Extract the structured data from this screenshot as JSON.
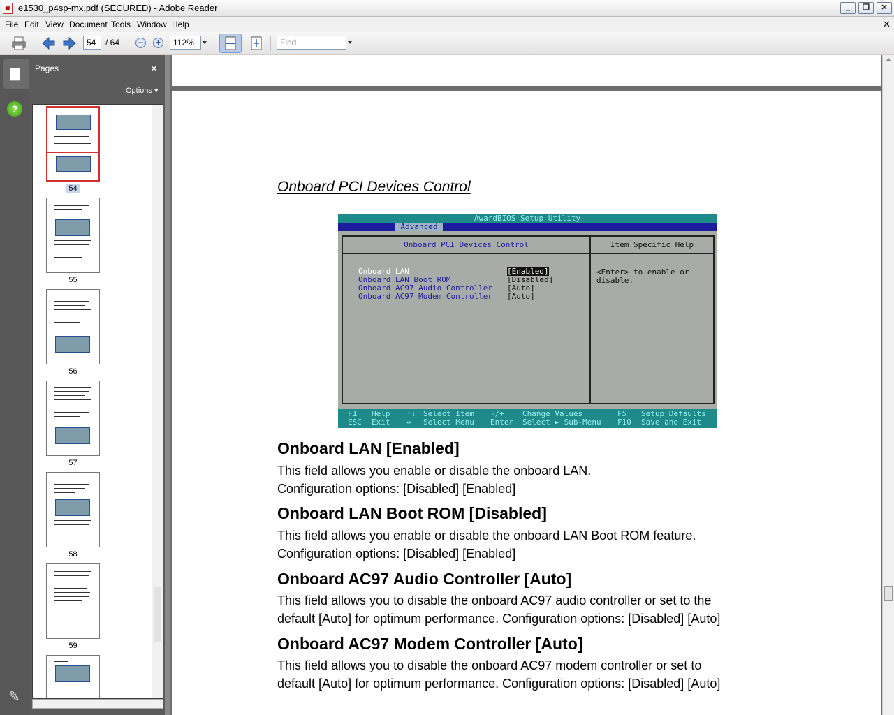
{
  "window": {
    "title": "e1530_p4sp-mx.pdf (SECURED) - Adobe Reader"
  },
  "menu": [
    "File",
    "Edit",
    "View",
    "Document",
    "Tools",
    "Window",
    "Help"
  ],
  "toolbar": {
    "current_page": "54",
    "page_total": "/ 64",
    "zoom": "112%",
    "find_placeholder": "Find"
  },
  "panel": {
    "title": "Pages",
    "options": "Options",
    "close": "×"
  },
  "thumbnails": [
    {
      "label": "54",
      "selected": true
    },
    {
      "label": "55"
    },
    {
      "label": "56"
    },
    {
      "label": "57"
    },
    {
      "label": "58"
    },
    {
      "label": "59"
    }
  ],
  "doc": {
    "section_title": "Onboard PCI Devices Control",
    "bios": {
      "utility": "AwardBIOS Setup Utility",
      "tab": "Advanced",
      "main_header": "Onboard PCI Devices Control",
      "help_header": "Item Specific Help",
      "items": [
        {
          "name": "Onboard LAN",
          "value": "[Enabled]"
        },
        {
          "name": "Onboard LAN Boot ROM",
          "value": "[Disabled]"
        },
        {
          "name": "Onboard AC97 Audio Controller",
          "value": "[Auto]"
        },
        {
          "name": "Onboard AC97 Modem Controller",
          "value": "[Auto]"
        }
      ],
      "help_text": "<Enter> to enable or disable.",
      "footer": {
        "k1": "F1",
        "d1": "Help",
        "k2": "↑↓",
        "d2": "Select Item",
        "k3": "-/+",
        "d3": "Change Values",
        "k4": "F5",
        "d4": "Setup Defaults",
        "k5": "ESC",
        "d5": "Exit",
        "k6": "↔",
        "d6": "Select Menu",
        "k7": "Enter",
        "d7": "Select ► Sub-Menu",
        "k8": "F10",
        "d8": "Save and Exit"
      }
    },
    "sections": [
      {
        "heading": "Onboard LAN [Enabled]",
        "lines": [
          "This field allows you enable or disable the onboard LAN.",
          "Configuration options: [Disabled] [Enabled]"
        ]
      },
      {
        "heading": "Onboard LAN Boot ROM [Disabled]",
        "lines": [
          "This field allows you enable or disable the onboard LAN Boot ROM feature.",
          "Configuration options: [Disabled] [Enabled]"
        ]
      },
      {
        "heading": "Onboard AC97 Audio Controller [Auto]",
        "lines": [
          "This field allows you to disable the onboard AC97 audio controller or set to the",
          "default [Auto] for optimum performance. Configuration options: [Disabled] [Auto]"
        ]
      },
      {
        "heading": "Onboard AC97 Modem Controller [Auto]",
        "lines": [
          "This field allows you to disable the onboard AC97 modem controller or set to",
          "default [Auto] for optimum performance. Configuration options: [Disabled] [Auto]"
        ]
      }
    ]
  }
}
